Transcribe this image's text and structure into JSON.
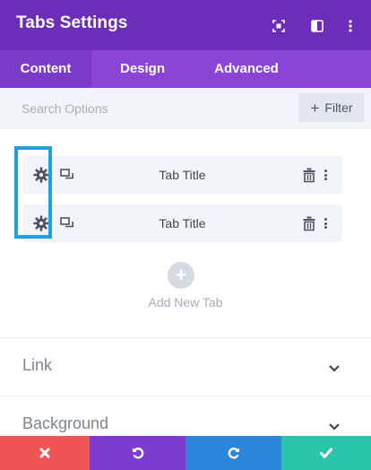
{
  "header": {
    "title": "Tabs Settings",
    "icons": [
      "expand-icon",
      "split-view-icon",
      "more-vertical-icon"
    ],
    "bg_color": "#6c2eb9"
  },
  "tabs": [
    {
      "label": "Content",
      "active": true
    },
    {
      "label": "Design",
      "active": false
    },
    {
      "label": "Advanced",
      "active": false
    }
  ],
  "search": {
    "placeholder": "Search Options",
    "value": "",
    "filter_label": "Filter"
  },
  "items": [
    {
      "label": "Tab Title"
    },
    {
      "label": "Tab Title"
    }
  ],
  "add_new": {
    "label": "Add New Tab"
  },
  "sections": [
    {
      "title": "Link",
      "expanded": false
    },
    {
      "title": "Background",
      "expanded": false
    }
  ],
  "footer": {
    "buttons": [
      {
        "name": "discard",
        "icon": "close-icon",
        "color": "#ef5555"
      },
      {
        "name": "undo",
        "icon": "undo-icon",
        "color": "#7d3bcf"
      },
      {
        "name": "redo",
        "icon": "redo-icon",
        "color": "#2b87da"
      },
      {
        "name": "save",
        "icon": "check-icon",
        "color": "#29c4a9"
      }
    ]
  },
  "accent_colors": {
    "highlight": "#1fa1e0",
    "tab_bar": "#8a45d6"
  }
}
